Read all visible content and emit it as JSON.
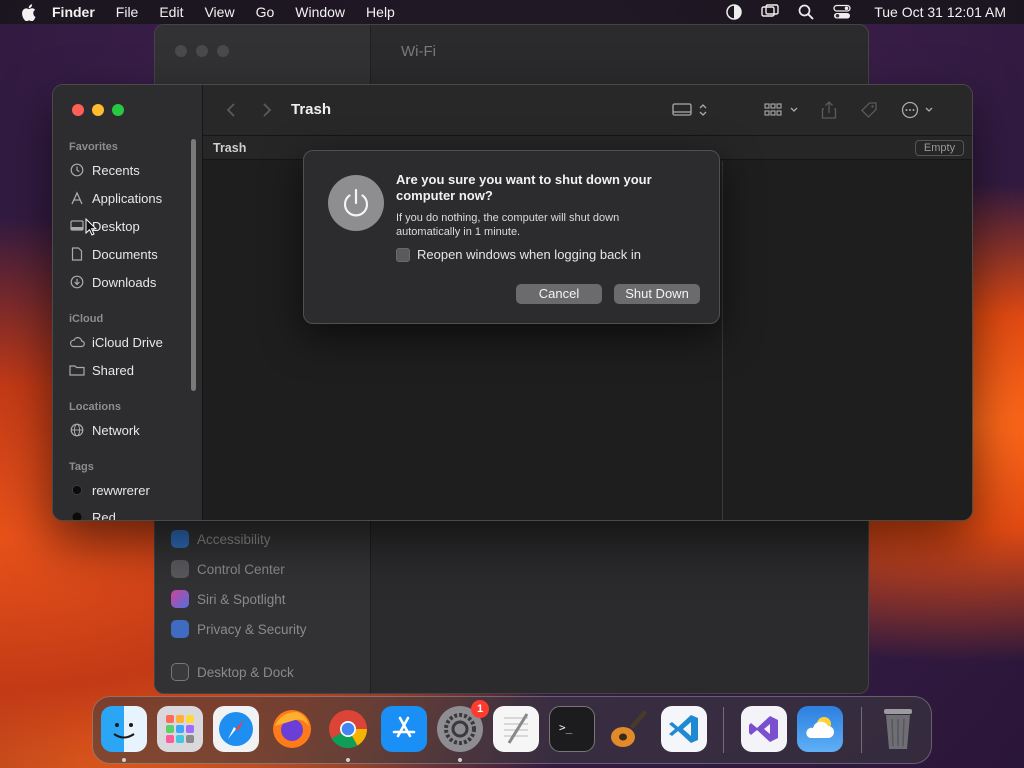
{
  "menubar": {
    "app_name": "Finder",
    "items": [
      "File",
      "Edit",
      "View",
      "Go",
      "Window",
      "Help"
    ],
    "clock": "Tue Oct 31  12:01 AM"
  },
  "settings_window": {
    "title": "Wi-Fi",
    "sidebar_items": [
      "Accessibility",
      "Control Center",
      "Siri & Spotlight",
      "Privacy & Security",
      "Desktop & Dock"
    ]
  },
  "finder": {
    "title": "Trash",
    "path_location": "Trash",
    "empty_button": "Empty",
    "sections": {
      "favorites": "Favorites",
      "icloud": "iCloud",
      "locations": "Locations",
      "tags": "Tags"
    },
    "favorites": [
      "Recents",
      "Applications",
      "Desktop",
      "Documents",
      "Downloads"
    ],
    "icloud_items": [
      "iCloud Drive",
      "Shared"
    ],
    "location_items": [
      "Network"
    ],
    "tag_items": [
      "rewwrerer",
      "Red"
    ]
  },
  "alert": {
    "heading": "Are you sure you want to shut down your computer now?",
    "body": "If you do nothing, the computer will shut down automatically in 1 minute.",
    "checkbox_label": "Reopen windows when logging back in",
    "checkbox_checked": false,
    "cancel_label": "Cancel",
    "confirm_label": "Shut Down"
  },
  "dock": {
    "apps": [
      "finder-icon",
      "launchpad-icon",
      "safari-icon",
      "firefox-icon",
      "chrome-icon",
      "app-store-icon",
      "system-settings-icon",
      "textedit-icon",
      "terminal-icon",
      "garageband-icon",
      "vscode-icon",
      "visual-studio-icon",
      "weather-icon",
      "trash-icon"
    ],
    "settings_badge": "1"
  },
  "colors": {
    "traffic_red": "#ff5f57",
    "traffic_yellow": "#febc2e",
    "traffic_green": "#28c840",
    "badge": "#ff3b30"
  }
}
